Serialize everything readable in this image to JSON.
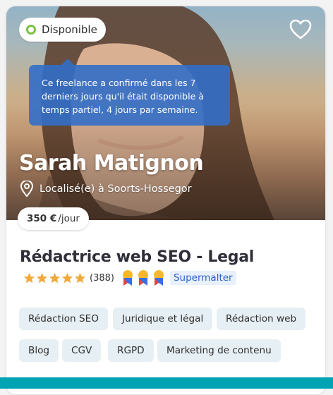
{
  "availability": {
    "label": "Disponible",
    "tooltip": "Ce freelance a confirmé dans les 7 derniers jours qu'il était disponible à temps partiel, 4 jours par semaine.",
    "status_color": "#7bc043"
  },
  "profile": {
    "name": "Sarah Matignon",
    "location": "Localisé(e) à Soorts-Hossegor",
    "price_amount": "350 €",
    "price_unit": "/jour",
    "title": "Rédactrice web SEO - Legal"
  },
  "rating": {
    "stars": 5,
    "count": "(388)",
    "badge_label": "Supermalter"
  },
  "tags": [
    "Rédaction SEO",
    "Juridique et légal",
    "Rédaction web",
    "Blog",
    "CGV",
    "RGPD",
    "Marketing de contenu"
  ],
  "colors": {
    "tooltip_bg": "#326ec8",
    "star": "#f2a93b",
    "badge_text": "#2f5fd1",
    "tag_bg": "#e6eff3",
    "accent_bar": "#00a3b4"
  },
  "icons": {
    "favorite": "heart-outline-icon",
    "location": "map-pin-icon",
    "availability": "status-ring-icon"
  }
}
